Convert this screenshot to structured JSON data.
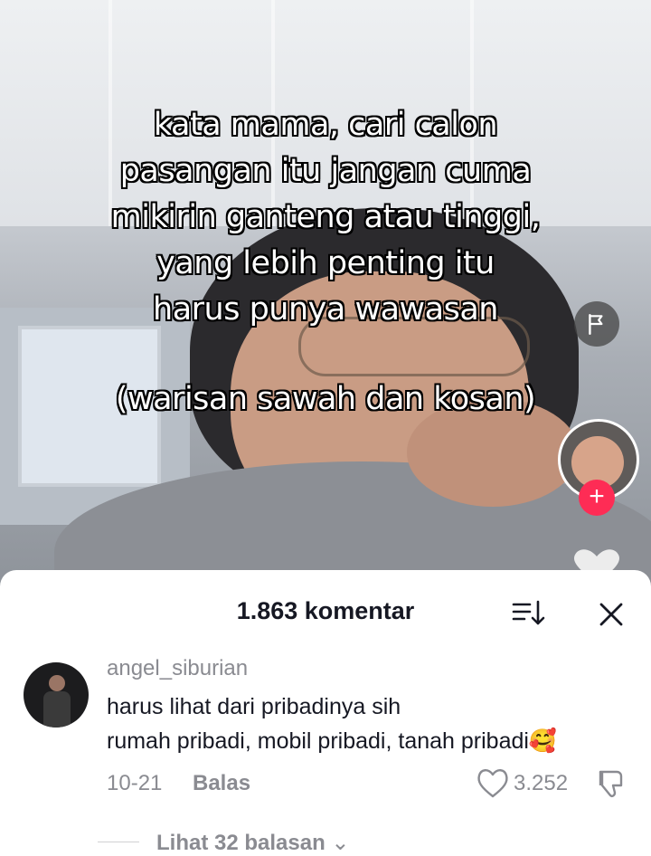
{
  "video": {
    "caption_lines": [
      "kata mama, cari calon",
      "pasangan itu jangan cuma",
      "mikirin ganteng atau tinggi,",
      "yang lebih penting itu",
      "harus punya wawasan"
    ],
    "caption_sub": "(warisan sawah dan kosan)",
    "plus_glyph": "+"
  },
  "comments_sheet": {
    "title": "1.863 komentar",
    "sort_icon": "sort-icon",
    "close_icon": "close-icon"
  },
  "comment": {
    "username": "angel_siburian",
    "line1": "harus lihat dari pribadinya sih",
    "line2": "rumah pribadi, mobil pribadi, tanah pribadi🥰",
    "date": "10-21",
    "reply_label": "Balas",
    "likes": "3.252",
    "view_replies": "Lihat 32 balasan",
    "view_replies_chevron": "⌄"
  },
  "colors": {
    "accent": "#fe2c55",
    "muted": "#8a8b91",
    "text": "#161823"
  }
}
